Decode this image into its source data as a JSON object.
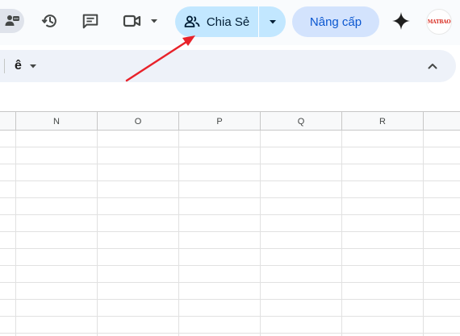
{
  "header": {
    "share_label": "Chia Sẻ",
    "upgrade_label": "Nâng cấp",
    "avatar_text": "MATBAO",
    "icons": {
      "profile": "person-settings-icon",
      "history": "history-icon",
      "comments": "comment-icon",
      "meet": "video-camera-icon",
      "share": "people-icon",
      "share_dropdown": "caret-down-icon",
      "gemini": "sparkle-icon"
    }
  },
  "toolbar": {
    "menu_text": "ê",
    "collapse_icon": "chevron-up-icon"
  },
  "sheet": {
    "columns": [
      "N",
      "O",
      "P",
      "Q",
      "R"
    ],
    "visible_rows": 12
  },
  "annotation": {
    "arrow_color": "#e8222a",
    "points_to": "share-button"
  },
  "colors": {
    "share_bg": "#c2e7ff",
    "upgrade_bg": "#d3e3fd",
    "upgrade_text": "#0b57d0",
    "toolbar_bg": "#eef2f9"
  }
}
